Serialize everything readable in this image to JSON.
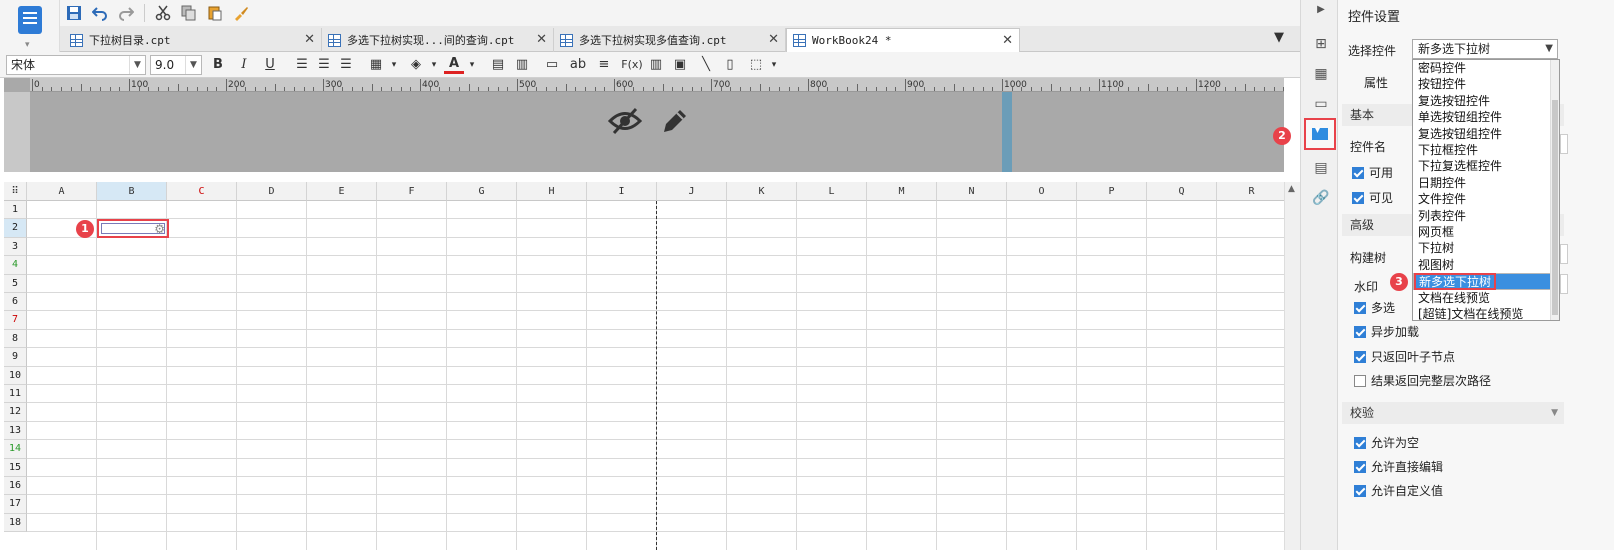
{
  "colors": {
    "accent": "#2f7fd6",
    "highlight": "#e8424a",
    "selected_item": "#3b8fe0"
  },
  "quickbar": {
    "icons": [
      "save-icon",
      "undo-icon",
      "redo-icon",
      "cut-icon",
      "copy-icon",
      "paste-icon",
      "format-painter-icon"
    ]
  },
  "tabs": [
    {
      "label": "下拉树目录.cpt",
      "active": false
    },
    {
      "label": "多选下拉树实现...间的查询.cpt",
      "active": false
    },
    {
      "label": "多选下拉树实现多值查询.cpt",
      "active": false
    },
    {
      "label": "WorkBook24 *",
      "active": true
    }
  ],
  "format": {
    "font": "宋体",
    "size": "9.0",
    "bold": "B",
    "italic": "I",
    "underline": "U",
    "text_tool": "ab",
    "formula": "F(x)"
  },
  "ruler": {
    "ticks": [
      "0",
      "100",
      "200",
      "300",
      "400",
      "500",
      "600",
      "700",
      "800",
      "900",
      "1000",
      "1100",
      "1200"
    ]
  },
  "sheet": {
    "columns": [
      "A",
      "B",
      "C",
      "D",
      "E",
      "F",
      "G",
      "H",
      "I",
      "J",
      "K",
      "L",
      "M",
      "N",
      "O",
      "P",
      "Q",
      "R"
    ],
    "rows": [
      "1",
      "2",
      "3",
      "4",
      "5",
      "6",
      "7",
      "8",
      "9",
      "10",
      "11",
      "12",
      "13",
      "14",
      "15",
      "16",
      "17",
      "18"
    ]
  },
  "badges": {
    "one": "1",
    "two": "2",
    "three": "3"
  },
  "panel": {
    "title": "控件设置",
    "select_label": "选择控件",
    "select_value": "新多选下拉树",
    "attr_tab": "属性",
    "basic": "基本",
    "name_label": "控件名",
    "enabled": "可用",
    "visible": "可见",
    "advanced": "高级",
    "build_tree": "构建树",
    "watermark": "水印",
    "multi": "多选",
    "async": "异步加载",
    "leaf_only": "只返回叶子节点",
    "full_path": "结果返回完整层次路径",
    "validate": "校验",
    "allow_empty": "允许为空",
    "allow_edit": "允许直接编辑",
    "allow_custom": "允许自定义值"
  },
  "dropdown": {
    "items": [
      "密码控件",
      "按钮控件",
      "复选按钮控件",
      "单选按钮组控件",
      "复选按钮组控件",
      "下拉框控件",
      "下拉复选框控件",
      "日期控件",
      "文件控件",
      "列表控件",
      "网页框",
      "下拉树",
      "视图树",
      "新多选下拉树",
      "文档在线预览",
      "[超链]文档在线预览"
    ],
    "selected_index": 13
  }
}
